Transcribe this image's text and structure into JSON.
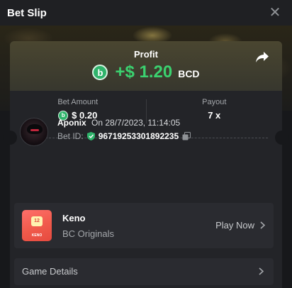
{
  "header": {
    "title": "Bet Slip",
    "close_glyph": "✕"
  },
  "profit": {
    "label": "Profit",
    "amount": "+$ 1.20",
    "currency": "BCD",
    "coin_icon": "bcd-coin-icon",
    "accent_color": "#3bd16f"
  },
  "bet_amount": {
    "label": "Bet Amount",
    "value": "$ 0.20"
  },
  "payout": {
    "label": "Payout",
    "value": "7 x"
  },
  "bet_info": {
    "username": "Aponix",
    "time": "On 28/7/2023, 11:14:05",
    "bet_id_label": "Bet ID:",
    "bet_id": "96719253301892235"
  },
  "game": {
    "name": "Keno",
    "provider": "BC Originals",
    "play_label": "Play Now",
    "thumb_text": "KENO",
    "thumb_tile": "12"
  },
  "game_details": {
    "label": "Game Details"
  }
}
